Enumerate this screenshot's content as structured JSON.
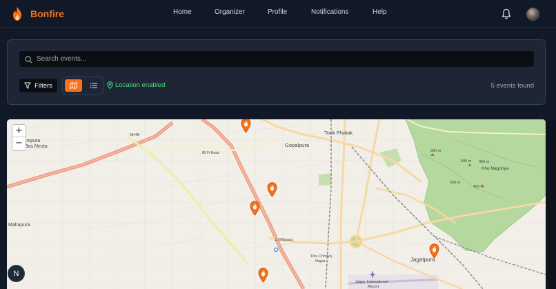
{
  "app": {
    "brand": "Bonfire",
    "brand_color": "#f97316"
  },
  "nav": {
    "items": [
      "Home",
      "Organizer",
      "Profile",
      "Notifications",
      "Help"
    ]
  },
  "header_icons": [
    "bell-icon",
    "avatar"
  ],
  "search": {
    "placeholder": "Search events..."
  },
  "toolbar": {
    "filters_label": "Filters",
    "view_modes": [
      "map",
      "list"
    ],
    "active_view": "map",
    "location_status": "Location enabled",
    "results_count": "5 events found"
  },
  "map": {
    "zoom_in": "+",
    "zoom_out": "−",
    "compass": "N",
    "pin_count": 5,
    "labels": {
      "hasampura": "Hasampura",
      "bas_neota": "Bas Neota",
      "nh48": "NH48",
      "mahapura": "Mahapura",
      "tonk_phatak": "Tonk Phatak",
      "gopalpura": "Gopalpura",
      "ring_road": "80 Ft Road",
      "e550": "550 m",
      "e500a": "500 m",
      "e450a": "450 m",
      "khol_nagoriya": "Kho Nagoriya",
      "e500b": "500 m",
      "e450b": "450 m",
      "jagatpura": "Jagatpura",
      "tilru": "Tilru Chhoya",
      "nagar": "Nagar",
      "airport": "Jaipur International",
      "airport2": "Airport",
      "bypass": "JLN Bypass"
    },
    "colors": {
      "land": "#f2efe9",
      "park": "#a8d08d",
      "major_road": "#f2a58a",
      "secondary_road": "#f7d8a4",
      "tertiary_road": "#f3f4a0",
      "rail": "#8a8a8a",
      "pin": "#f97316"
    }
  }
}
